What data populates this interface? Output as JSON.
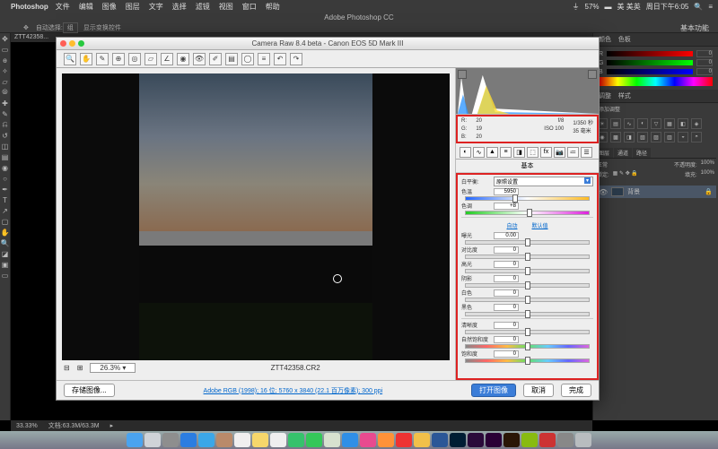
{
  "menubar": {
    "app": "Photoshop",
    "items": [
      "文件",
      "编辑",
      "图像",
      "图层",
      "文字",
      "选择",
      "滤镜",
      "视图",
      "窗口",
      "帮助"
    ],
    "right": {
      "wifi": "57%",
      "locale": "美 美英",
      "date": "周日下午6:05"
    }
  },
  "app_title": "Adobe Photoshop CC",
  "optbar": {
    "mode": "自动选择:",
    "dropdown": "组",
    "extra": "显示变换控件",
    "right_label": "基本功能"
  },
  "doc_tab": "ZTT42358...",
  "right_panel": {
    "color_tab": "颜色",
    "swatch_tab": "色板",
    "rgb": {
      "r": "0",
      "g": "0",
      "b": "0"
    },
    "adjust_tab1": "调整",
    "adjust_tab2": "样式",
    "add_adjust": "添加调整",
    "layers": {
      "tabs": [
        "图层",
        "通道",
        "路径"
      ],
      "blend": "正常",
      "opacity_label": "不透明度:",
      "opacity": "100%",
      "lock": "锁定:",
      "fill_label": "填充:",
      "fill": "100%",
      "bg": "背景"
    }
  },
  "status": {
    "zoom": "33.33%",
    "doc": "文档:63.3M/63.3M"
  },
  "cr": {
    "title": "Camera Raw 8.4 beta  -  Canon EOS 5D Mark III",
    "zoom": "26.3%",
    "filename": "ZTT42358.CR2",
    "meta": {
      "r": "R:",
      "rv": "20",
      "f": "f/8",
      "shutter": "1/350 秒",
      "g": "G:",
      "gv": "19",
      "iso": "ISO 100",
      "focal": "35 毫米",
      "b": "B:",
      "bv": "20"
    },
    "basic_tab": "基本",
    "wb": {
      "label": "白平衡:",
      "value": "原照设置"
    },
    "temp": {
      "label": "色温",
      "value": "5950"
    },
    "tint": {
      "label": "色调",
      "value": "+8"
    },
    "auto": "自动",
    "default": "默认值",
    "exposure": {
      "label": "曝光",
      "value": "0.00"
    },
    "contrast": {
      "label": "对比度",
      "value": "0"
    },
    "highlights": {
      "label": "高光",
      "value": "0"
    },
    "shadows": {
      "label": "阴影",
      "value": "0"
    },
    "whites": {
      "label": "白色",
      "value": "0"
    },
    "blacks": {
      "label": "黑色",
      "value": "0"
    },
    "clarity": {
      "label": "清晰度",
      "value": "0"
    },
    "vibrance": {
      "label": "自然饱和度",
      "value": "0"
    },
    "saturation": {
      "label": "饱和度",
      "value": "0"
    },
    "save": "存储图像...",
    "workflow": "Adobe RGB (1998); 16 位; 5760 x 3840 (22.1 百万像素); 300 ppi",
    "open": "打开图像",
    "cancel": "取消",
    "done": "完成"
  },
  "dock": [
    {
      "n": "finder",
      "c": "#4aa3ef"
    },
    {
      "n": "launchpad",
      "c": "#cfd3d8"
    },
    {
      "n": "settings",
      "c": "#8e8e8e"
    },
    {
      "n": "safari",
      "c": "#2b7de1"
    },
    {
      "n": "mail",
      "c": "#3ba7e8"
    },
    {
      "n": "contacts",
      "c": "#b98a6a"
    },
    {
      "n": "calendar",
      "c": "#f0efef"
    },
    {
      "n": "notes",
      "c": "#f6d76b"
    },
    {
      "n": "reminders",
      "c": "#efefef"
    },
    {
      "n": "messages",
      "c": "#36c26c"
    },
    {
      "n": "facetime",
      "c": "#34c759"
    },
    {
      "n": "maps",
      "c": "#d7e1cf"
    },
    {
      "n": "appstore",
      "c": "#2f8fe6"
    },
    {
      "n": "itunes",
      "c": "#e84a8f"
    },
    {
      "n": "ibooks",
      "c": "#ff9238"
    },
    {
      "n": "qq",
      "c": "#e33"
    },
    {
      "n": "chrome",
      "c": "#f1c04a"
    },
    {
      "n": "word",
      "c": "#2b5797"
    },
    {
      "n": "photoshop",
      "c": "#001d34"
    },
    {
      "n": "aftereffects",
      "c": "#2a0a3a"
    },
    {
      "n": "premiere",
      "c": "#2a0036"
    },
    {
      "n": "bridge",
      "c": "#2a1606"
    },
    {
      "n": "app1",
      "c": "#8b1"
    },
    {
      "n": "app2",
      "c": "#c33"
    },
    {
      "n": "app3",
      "c": "#888"
    },
    {
      "n": "trash",
      "c": "#b8bcbf"
    }
  ]
}
